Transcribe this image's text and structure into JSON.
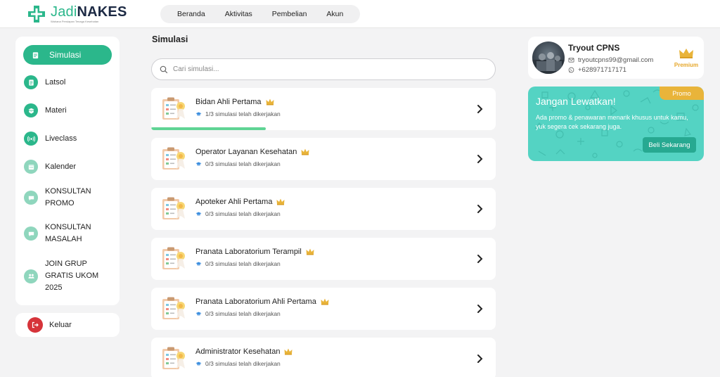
{
  "brand": {
    "name_part1": "Jadi",
    "name_part2": "NAKES",
    "tagline": "Wahana Persiapan Tenaga Kesehatan",
    "primary_color": "#2bb78b"
  },
  "nav": {
    "items": [
      {
        "label": "Beranda"
      },
      {
        "label": "Aktivitas"
      },
      {
        "label": "Pembelian"
      },
      {
        "label": "Akun"
      }
    ]
  },
  "sidebar": {
    "items": [
      {
        "label": "Simulasi",
        "icon": "clipboard-icon",
        "active": true
      },
      {
        "label": "Latsol",
        "icon": "document-icon"
      },
      {
        "label": "Materi",
        "icon": "book-icon"
      },
      {
        "label": "Liveclass",
        "icon": "broadcast-icon"
      },
      {
        "label": "Kalender",
        "icon": "calendar-icon"
      },
      {
        "label": "KONSULTAN PROMO",
        "icon": "chat-icon"
      },
      {
        "label": "KONSULTAN MASALAH",
        "icon": "chat-icon"
      },
      {
        "label": "JOIN GRUP GRATIS UKOM 2025",
        "icon": "group-icon"
      }
    ],
    "logout_label": "Keluar"
  },
  "main": {
    "title": "Simulasi",
    "search_placeholder": "Cari simulasi...",
    "cards": [
      {
        "title": "Bidan Ahli Pertama",
        "progress_text": "1/3 simulasi telah dikerjakan",
        "progress": 0.333
      },
      {
        "title": "Operator Layanan Kesehatan",
        "progress_text": "0/3 simulasi telah dikerjakan",
        "progress": 0
      },
      {
        "title": "Apoteker Ahli Pertama",
        "progress_text": "0/3 simulasi telah dikerjakan",
        "progress": 0
      },
      {
        "title": "Pranata Laboratorium Terampil",
        "progress_text": "0/3 simulasi telah dikerjakan",
        "progress": 0
      },
      {
        "title": "Pranata Laboratorium Ahli Pertama",
        "progress_text": "0/3 simulasi telah dikerjakan",
        "progress": 0
      },
      {
        "title": "Administrator Kesehatan",
        "progress_text": "0/3 simulasi telah dikerjakan",
        "progress": 0
      }
    ]
  },
  "profile": {
    "name": "Tryout CPNS",
    "email": "tryoutcpns99@gmail.com",
    "phone": "+628971717171",
    "badge": "Premium"
  },
  "promo": {
    "badge": "Promo",
    "title": "Jangan Lewatkan!",
    "text": "Ada promo & penawaran menarik khusus untuk kamu, yuk segera cek sekarang juga.",
    "button": "Beli Sekarang"
  }
}
